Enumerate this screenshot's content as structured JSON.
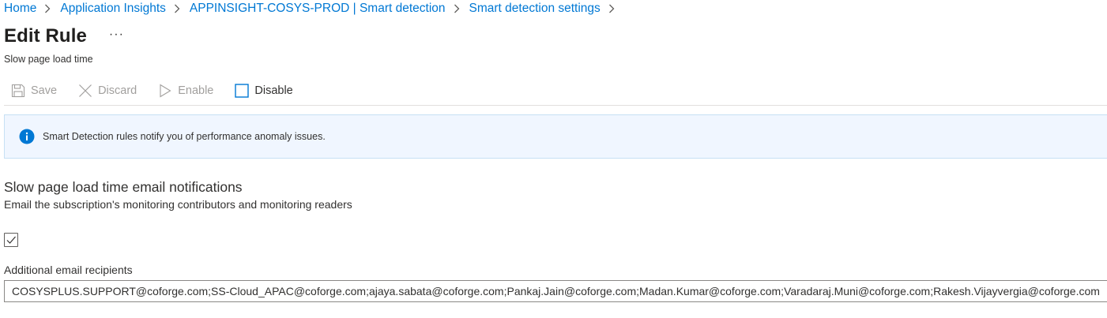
{
  "breadcrumb": {
    "items": [
      {
        "label": "Home"
      },
      {
        "label": "Application Insights"
      },
      {
        "label": "APPINSIGHT-COSYS-PROD | Smart detection"
      },
      {
        "label": "Smart detection settings"
      }
    ]
  },
  "header": {
    "title": "Edit Rule",
    "more_label": "···",
    "subtitle": "Slow page load time"
  },
  "toolbar": {
    "save_label": "Save",
    "discard_label": "Discard",
    "enable_label": "Enable",
    "disable_label": "Disable",
    "save_icon": "save-icon",
    "discard_icon": "close-icon",
    "enable_icon": "play-icon",
    "disable_icon": "checkbox-empty-icon"
  },
  "info_banner": {
    "icon": "info-icon",
    "text": "Smart Detection rules notify you of performance anomaly issues."
  },
  "email_section": {
    "title": "Slow page load time email notifications",
    "description": "Email the subscription's monitoring contributors and monitoring readers",
    "checkbox_checked": true,
    "recipients_label": "Additional email recipients",
    "recipients_value": "COSYSPLUS.SUPPORT@coforge.com;SS-Cloud_APAC@coforge.com;ajaya.sabata@coforge.com;Pankaj.Jain@coforge.com;Madan.Kumar@coforge.com;Varadaraj.Muni@coforge.com;Rakesh.Vijayvergia@coforge.com"
  },
  "colors": {
    "link": "#0078d4",
    "info_banner_bg": "#f0f6ff",
    "disabled_text": "#a19f9d",
    "info_icon": "#0078d4"
  }
}
